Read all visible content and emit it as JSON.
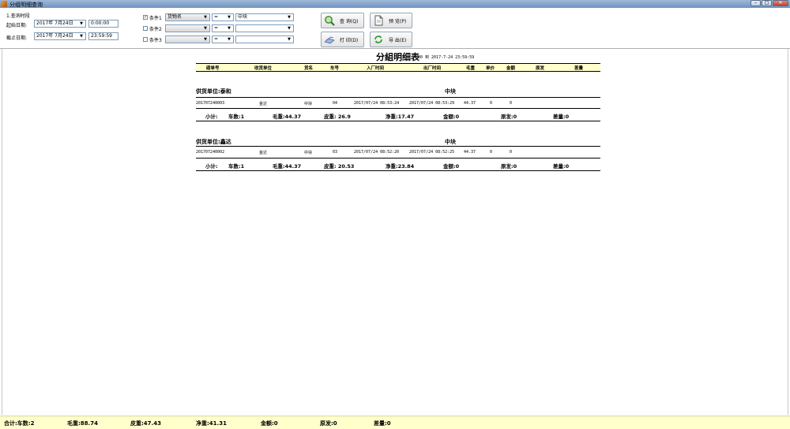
{
  "window": {
    "title": "分组明细查询",
    "min": "–",
    "max": "□",
    "close": "✕"
  },
  "query": {
    "section_label": "1.查询时段",
    "start_label": "起始日期:",
    "start_date": "2017年 7月24日",
    "start_time": "0:00:00",
    "end_label": "截止日期:",
    "end_date": "2017年 7月24日",
    "end_time": "23:59:59"
  },
  "conditions": [
    {
      "checked": true,
      "label": "条件1",
      "field": "货物名",
      "op": "=",
      "value": "中块"
    },
    {
      "checked": false,
      "label": "条件2",
      "field": "",
      "op": "=",
      "value": ""
    },
    {
      "checked": false,
      "label": "条件3",
      "field": "",
      "op": "=",
      "value": ""
    }
  ],
  "buttons": {
    "query": "查 询(Q)",
    "preview": "预 览(P)",
    "print": "打 印(D)",
    "export": "导 出(E)"
  },
  "report": {
    "title": "分組明细表",
    "range": "00 到 2017-7-24 23:59:59",
    "columns": [
      "磅单号",
      "收货单位",
      "货名",
      "车号",
      "入厂时间",
      "出厂时间",
      "毛重",
      "单价",
      "金额",
      "原发",
      "差量"
    ],
    "groups": [
      {
        "supplier": "供货单位:泰和",
        "goods": "中块",
        "row": {
          "id": "201707240003",
          "receiver": "金达",
          "goods": "中块",
          "truck": "04",
          "in": "2017/07/24 08:53:24",
          "out": "2017/07/24 08:53:29",
          "gross": "44.37",
          "price": "0",
          "amount": "0"
        },
        "subtotal": {
          "label": "小计:",
          "count": "车数:1",
          "gross": "毛重:44.37",
          "tare": "皮重: 26.9",
          "net": "净重:17.47",
          "amount": "金额:0",
          "orig": "原发:0",
          "diff": "差量:0"
        }
      },
      {
        "supplier": "供货单位:鑫达",
        "goods": "中块",
        "row": {
          "id": "201707240002",
          "receiver": "金达",
          "goods": "中块",
          "truck": "03",
          "in": "2017/07/24 08:52:20",
          "out": "2017/07/24 08:52:25",
          "gross": "44.37",
          "price": "0",
          "amount": "0"
        },
        "subtotal": {
          "label": "小计:",
          "count": "车数:1",
          "gross": "毛重:44.37",
          "tare": "皮重: 20.53",
          "net": "净重:23.84",
          "amount": "金额:0",
          "orig": "原发:0",
          "diff": "差量:0"
        }
      }
    ]
  },
  "footer": {
    "count": "合计:车数:2",
    "gross": "毛重:88.74",
    "tare": "皮重:47.43",
    "net": "净重:41.31",
    "amount": "金额:0",
    "orig": "原发:0",
    "diff": "差量:0"
  },
  "colors": {
    "accent": "#ffffcc",
    "titlebar": "#6f93bf"
  }
}
